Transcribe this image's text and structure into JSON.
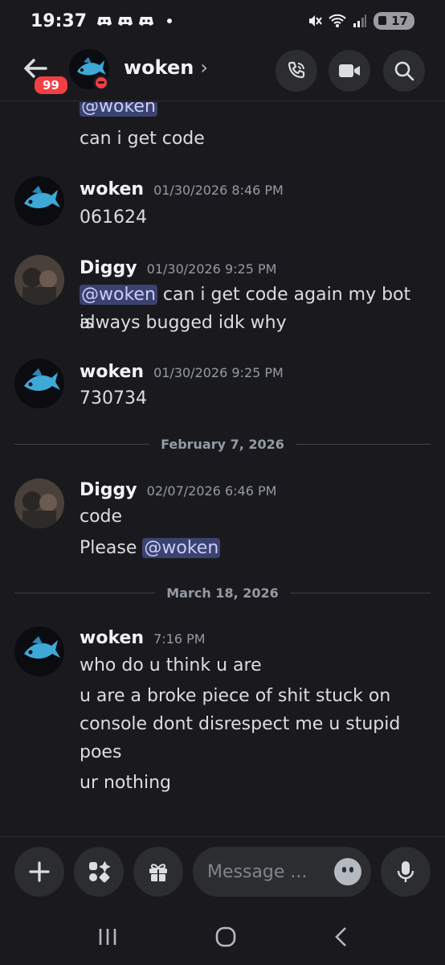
{
  "status_bar": {
    "time": "19:37",
    "battery": "17"
  },
  "header": {
    "unread_badge": "99",
    "name": "woken",
    "chevron": "›"
  },
  "messages": {
    "m0": {
      "mention": "@woken",
      "line2": "can i get code"
    },
    "m1": {
      "author": "woken",
      "time": "01/30/2026 8:46 PM",
      "lines": [
        "061624"
      ]
    },
    "m2": {
      "author": "Diggy",
      "time": "01/30/2026 9:25 PM",
      "mention": "@woken",
      "text_a": " can i get code again my bot is",
      "text_b": "always bugged idk why"
    },
    "m3": {
      "author": "woken",
      "time": "01/30/2026 9:25 PM",
      "lines": [
        "730734"
      ]
    },
    "divider1": "February 7, 2026",
    "m4": {
      "author": "Diggy",
      "time": "02/07/2026 6:46 PM",
      "line1": "code",
      "line2_prefix": "Please ",
      "mention": "@woken"
    },
    "divider2": "March 18, 2026",
    "m5": {
      "author": "woken",
      "time": "7:16 PM",
      "lines": [
        "who do u think u are",
        "u are a broke piece of shit stuck on",
        "console dont disrespect me u stupid",
        "poes",
        "ur nothing"
      ]
    }
  },
  "composer": {
    "placeholder": "Message ..."
  },
  "colors": {
    "background": "#1a1a1e",
    "mention_bg": "#3c4270",
    "dnd_red": "#f23f43"
  }
}
